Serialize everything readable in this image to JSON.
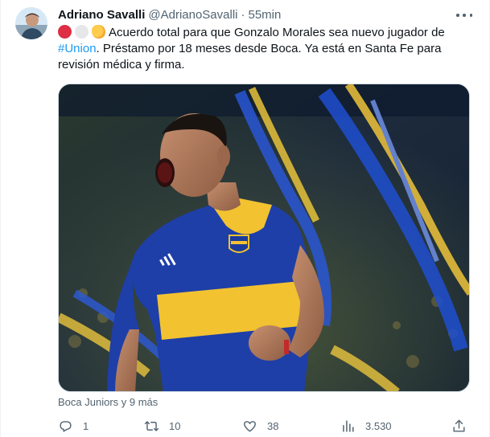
{
  "tweet": {
    "author_name": "Adriano Savalli",
    "author_handle": "@AdrianoSavalli",
    "separator": "·",
    "time": "55min",
    "text_part1": "Acuerdo total para que Gonzalo Morales sea nuevo jugador de ",
    "hashtag": "#Union",
    "text_part2": ". Préstamo por 18 meses desde Boca. Ya está en Santa Fe para revisión médica y firma.",
    "emojis": [
      "red-circle",
      "white-circle",
      "handshake"
    ],
    "tagged": "Boca Juniors y 9 más",
    "media_icon_names": [
      "player-photo",
      "boca-crest-icon",
      "adidas-logo-icon"
    ]
  },
  "actions": {
    "reply_count": "1",
    "retweet_count": "10",
    "like_count": "38",
    "views_count": "3.530"
  },
  "colors": {
    "accent": "#1d9bf0",
    "text": "#0f1419",
    "muted": "#536471",
    "boca_blue": "#1e3fa8",
    "boca_gold": "#f2c230"
  },
  "icons": [
    "more-icon",
    "reply-icon",
    "retweet-icon",
    "like-icon",
    "views-icon",
    "share-icon"
  ]
}
